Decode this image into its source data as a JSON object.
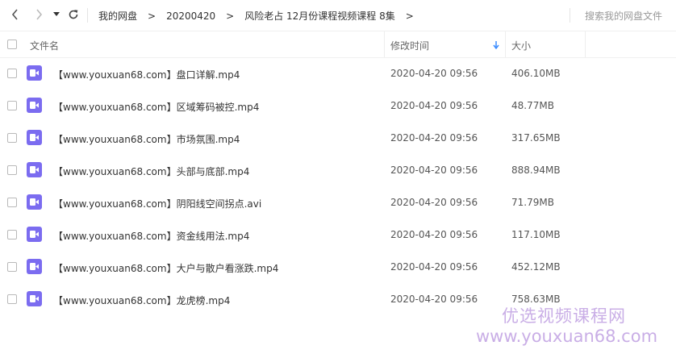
{
  "nav": {
    "breadcrumbs": [
      "我的网盘",
      "20200420",
      "风险老占 12月份课程视频课程 8集"
    ],
    "separator": ">",
    "search_placeholder": "搜索我的网盘文件"
  },
  "header": {
    "col_name": "文件名",
    "col_modified": "修改时间",
    "col_size": "大小"
  },
  "files": [
    {
      "name": "【www.youxuan68.com】盘口详解.mp4",
      "modified": "2020-04-20 09:56",
      "size": "406.10MB"
    },
    {
      "name": "【www.youxuan68.com】区域筹码被控.mp4",
      "modified": "2020-04-20 09:56",
      "size": "48.77MB"
    },
    {
      "name": "【www.youxuan68.com】市场氛围.mp4",
      "modified": "2020-04-20 09:56",
      "size": "317.65MB"
    },
    {
      "name": "【www.youxuan68.com】头部与底部.mp4",
      "modified": "2020-04-20 09:56",
      "size": "888.94MB"
    },
    {
      "name": "【www.youxuan68.com】阴阳线空间拐点.avi",
      "modified": "2020-04-20 09:56",
      "size": "71.79MB"
    },
    {
      "name": "【www.youxuan68.com】资金线用法.mp4",
      "modified": "2020-04-20 09:56",
      "size": "117.10MB"
    },
    {
      "name": "【www.youxuan68.com】大户与散户看涨跌.mp4",
      "modified": "2020-04-20 09:56",
      "size": "452.12MB"
    },
    {
      "name": "【www.youxuan68.com】龙虎榜.mp4",
      "modified": "2020-04-20 09:56",
      "size": "758.63MB"
    }
  ],
  "watermark": {
    "line1": "优选视频课程网",
    "line2": "www.youxuan68.com"
  },
  "colors": {
    "video_icon": "#7b6cf0",
    "sort_arrow": "#3b8cff",
    "watermark": "#c9aee6"
  }
}
